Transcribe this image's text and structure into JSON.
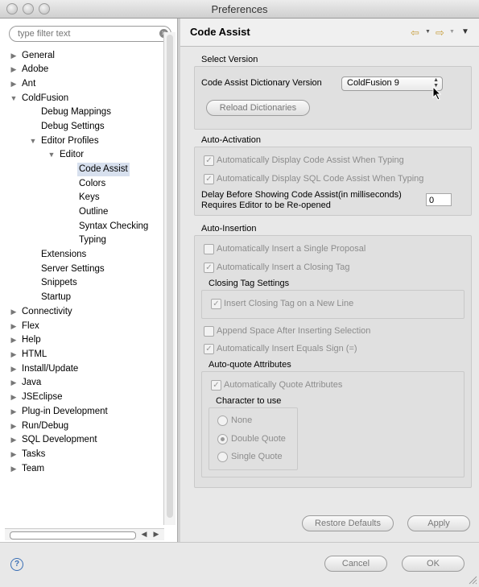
{
  "window": {
    "title": "Preferences"
  },
  "filter": {
    "placeholder": "type filter text"
  },
  "tree": [
    {
      "label": "General",
      "expanded": false
    },
    {
      "label": "Adobe",
      "expanded": false
    },
    {
      "label": "Ant",
      "expanded": false
    },
    {
      "label": "ColdFusion",
      "expanded": true
    },
    {
      "label": "Debug Mappings"
    },
    {
      "label": "Debug Settings"
    },
    {
      "label": "Editor Profiles",
      "expanded": true
    },
    {
      "label": "Editor",
      "expanded": true
    },
    {
      "label": "Code Assist",
      "selected": true
    },
    {
      "label": "Colors"
    },
    {
      "label": "Keys"
    },
    {
      "label": "Outline"
    },
    {
      "label": "Syntax Checking"
    },
    {
      "label": "Typing"
    },
    {
      "label": "Extensions"
    },
    {
      "label": "Server Settings"
    },
    {
      "label": "Snippets"
    },
    {
      "label": "Startup"
    },
    {
      "label": "Connectivity",
      "expanded": false
    },
    {
      "label": "Flex",
      "expanded": false
    },
    {
      "label": "Help",
      "expanded": false
    },
    {
      "label": "HTML",
      "expanded": false
    },
    {
      "label": "Install/Update",
      "expanded": false
    },
    {
      "label": "Java",
      "expanded": false
    },
    {
      "label": "JSEclipse",
      "expanded": false
    },
    {
      "label": "Plug-in Development",
      "expanded": false
    },
    {
      "label": "Run/Debug",
      "expanded": false
    },
    {
      "label": "SQL Development",
      "expanded": false
    },
    {
      "label": "Tasks",
      "expanded": false
    },
    {
      "label": "Team",
      "expanded": false
    }
  ],
  "page": {
    "title": "Code Assist"
  },
  "select_version": {
    "heading": "Select Version",
    "dictionary_label": "Code Assist Dictionary Version",
    "dictionary_value": "ColdFusion 9",
    "reload_button": "Reload Dictionaries"
  },
  "auto_activation": {
    "heading": "Auto-Activation",
    "display_code_assist": "Automatically Display Code Assist When Typing",
    "display_sql_assist": "Automatically Display SQL Code Assist When Typing",
    "delay_label_1": "Delay Before Showing Code Assist(in milliseconds)",
    "delay_label_2": "Requires Editor to be Re-opened",
    "delay_value": "0"
  },
  "auto_insertion": {
    "heading": "Auto-Insertion",
    "single_proposal": "Automatically Insert a Single Proposal",
    "closing_tag": "Automatically Insert a Closing Tag",
    "closing_tag_settings": "Closing Tag Settings",
    "closing_tag_new_line": "Insert Closing Tag on a New Line",
    "append_space": "Append Space After Inserting Selection",
    "equals_sign": "Automatically Insert Equals Sign (=)",
    "auto_quote_heading": "Auto-quote Attributes",
    "auto_quote": "Automatically Quote Attributes",
    "char_heading": "Character to use",
    "char_options": [
      "None",
      "Double Quote",
      "Single Quote"
    ]
  },
  "buttons": {
    "restore_defaults": "Restore Defaults",
    "apply": "Apply",
    "cancel": "Cancel",
    "ok": "OK"
  }
}
